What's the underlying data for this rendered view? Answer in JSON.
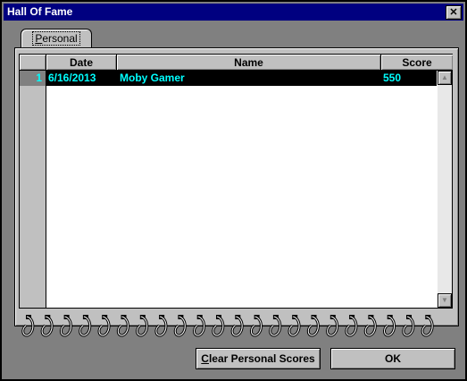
{
  "window": {
    "title": "Hall Of Fame",
    "close_glyph": "✕"
  },
  "tabs": [
    {
      "label": "Personal",
      "mnemonic": "P",
      "rest": "ersonal"
    }
  ],
  "table": {
    "columns": [
      "Date",
      "Name",
      "Score"
    ],
    "rows": [
      {
        "index": "1",
        "date": "6/16/2013",
        "name": "Moby Gamer",
        "score": "550"
      }
    ]
  },
  "buttons": {
    "clear": {
      "label": "Clear Personal Scores",
      "mnemonic": "C",
      "rest": "lear Personal Scores"
    },
    "ok": {
      "label": "OK"
    }
  },
  "icons": {
    "scroll_up": "up-arrow",
    "scroll_down": "down-arrow",
    "decor": "spiral-binding"
  },
  "colors": {
    "titlebar": "#000080",
    "selection_bg": "#000000",
    "selection_text": "#00ffff",
    "face": "#c0c0c0"
  }
}
